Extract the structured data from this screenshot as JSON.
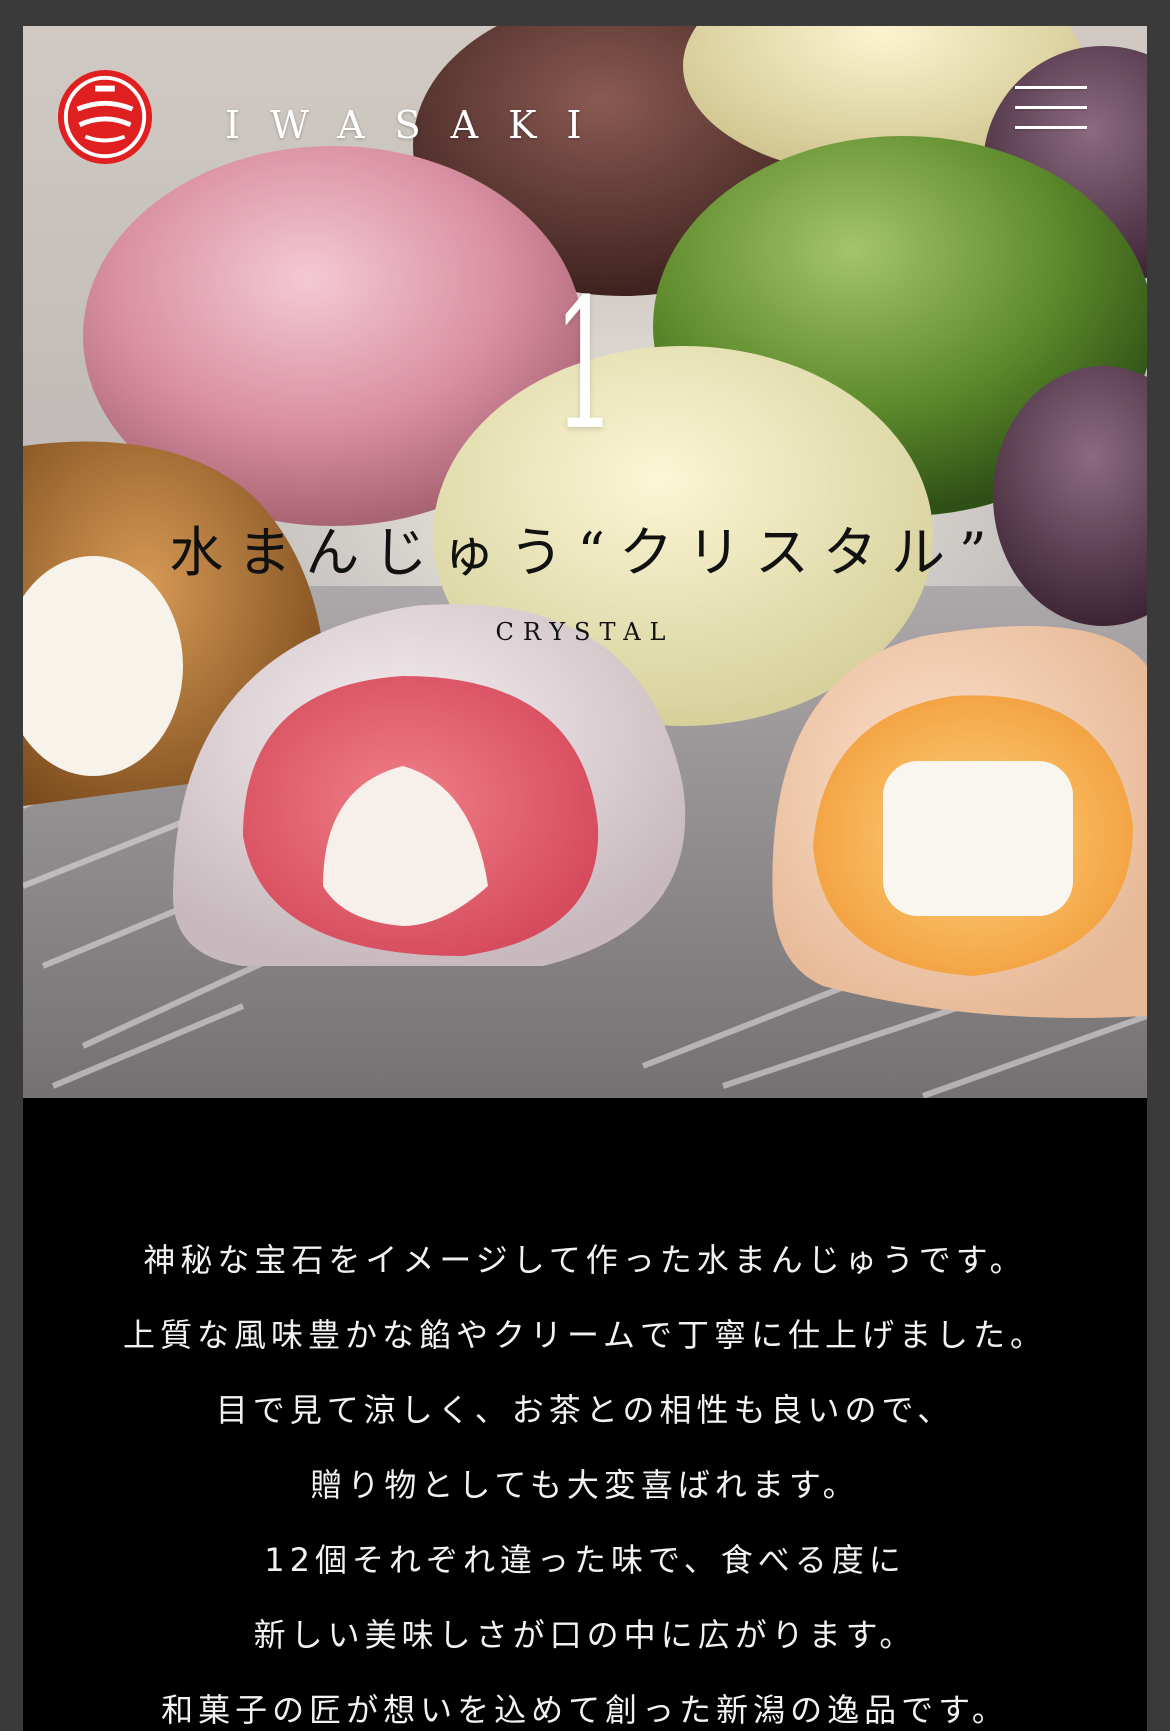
{
  "header": {
    "brand": "IWASAKI",
    "logo_icon": "iwasaki-crest-logo",
    "menu_icon": "hamburger-menu-icon",
    "brand_color": "#e02020"
  },
  "hero": {
    "number": "1",
    "title_jp": "水まんじゅう“クリスタル”",
    "title_en": "CRYSTAL"
  },
  "description": {
    "lines": [
      "神秘な宝石をイメージして作った水まんじゅうです。",
      "上質な風味豊かな餡やクリームで丁寧に仕上げました。",
      "目で見て涼しく、お茶との相性も良いので、",
      "贈り物としても大変喜ばれます。",
      "12個それぞれ違った味で、食べる度に",
      "新しい美味しさが口の中に広がります。",
      "和菓子の匠が想いを込めて創った新潟の逸品です。"
    ]
  }
}
